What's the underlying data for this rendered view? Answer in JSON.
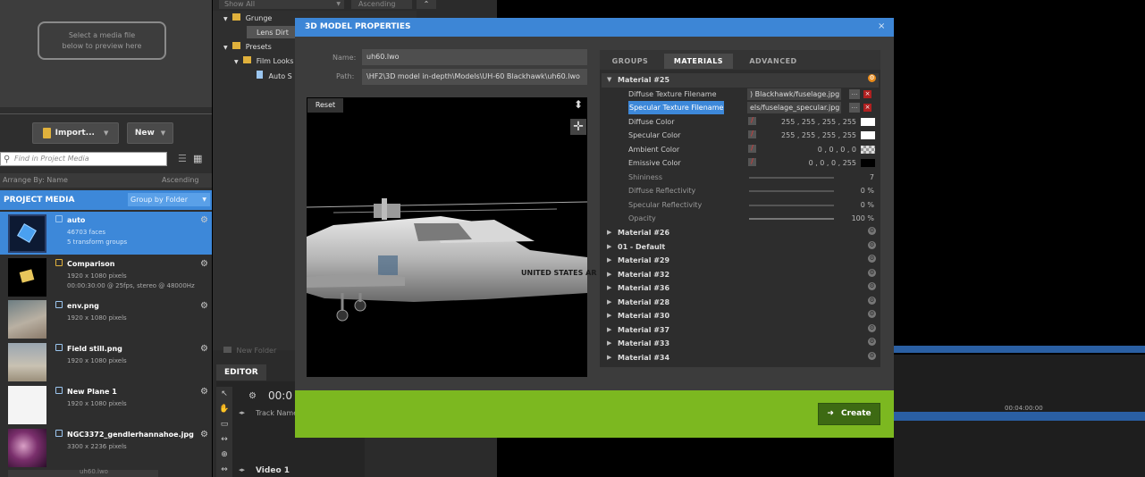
{
  "preview": {
    "text": "Select a media file\nbelow to preview here"
  },
  "toolbar": {
    "import_label": "Import...",
    "new_label": "New"
  },
  "search": {
    "placeholder": "Find in Project Media"
  },
  "arrange": {
    "label": "Arrange By: Name",
    "order": "Ascending"
  },
  "project_media": {
    "title": "PROJECT MEDIA",
    "group_by": "Group by Folder"
  },
  "media_items": [
    {
      "name": "auto",
      "meta": "46703 faces\n5 transform groups"
    },
    {
      "name": "Comparison",
      "meta": "1920 x 1080 pixels\n00:00:30:00 @ 25fps, stereo @ 48000Hz"
    },
    {
      "name": "env.png",
      "meta": "1920 x 1080 pixels"
    },
    {
      "name": "Field still.png",
      "meta": "1920 x 1080 pixels"
    },
    {
      "name": "New Plane 1",
      "meta": "1920 x 1080 pixels"
    },
    {
      "name": "NGC3372_gendlerhannahoe.jpg",
      "meta": "3300 x 2236 pixels"
    },
    {
      "name": "uh60.lwo",
      "meta": ""
    }
  ],
  "mid": {
    "show_all": "Show All",
    "ascending": "Ascending",
    "tree": [
      "Grunge",
      "Lens Dirt",
      "Presets",
      "Film Looks",
      "Auto S"
    ],
    "new_folder": "New Folder",
    "editor_tab": "EDITOR",
    "timecode": "00:0",
    "track_name": "Track Name",
    "video1": "Video 1"
  },
  "timeline": {
    "label": "00:04:00:00"
  },
  "dialog": {
    "title": "3D MODEL PROPERTIES",
    "close": "×",
    "name_label": "Name:",
    "name_value": "uh60.lwo",
    "path_label": "Path:",
    "path_value": "\\HF2\\3D model in-depth\\Models\\UH-60 Blackhawk\\uh60.lwo",
    "reset_label": "Reset",
    "fuselage_text": "UNITED STATES AR",
    "tabs": [
      "GROUPS",
      "MATERIALS",
      "ADVANCED"
    ],
    "material25": {
      "name": "Material #25",
      "diffuse_tex_label": "Diffuse Texture Filename",
      "diffuse_tex_value": ") Blackhawk/fuselage.jpg",
      "specular_tex_label": "Specular Texture Filename",
      "specular_tex_value": "els/fuselage_specular.jpg",
      "diffuse_color_label": "Diffuse Color",
      "diffuse_color_value": "255 ,  255 ,  255 ,  255",
      "specular_color_label": "Specular Color",
      "specular_color_value": "255 ,  255 ,  255 ,  255",
      "ambient_color_label": "Ambient Color",
      "ambient_color_value": "0 ,  0 ,  0 ,  0",
      "emissive_color_label": "Emissive Color",
      "emissive_color_value": "0 ,  0 ,  0 ,  255",
      "shininess_label": "Shininess",
      "shininess_value": "7",
      "diffuse_refl_label": "Diffuse Reflectivity",
      "diffuse_refl_value": "0 %",
      "specular_refl_label": "Specular Reflectivity",
      "specular_refl_value": "0 %",
      "opacity_label": "Opacity",
      "opacity_value": "100 %"
    },
    "materials": [
      "Material #26",
      "01 - Default",
      "Material #29",
      "Material #32",
      "Material #36",
      "Material #28",
      "Material #30",
      "Material #37",
      "Material #33",
      "Material #34"
    ],
    "create_label": "Create"
  },
  "colors": {
    "accent": "#3d88d9",
    "footer": "#7cb820",
    "create": "#3d6a13"
  }
}
